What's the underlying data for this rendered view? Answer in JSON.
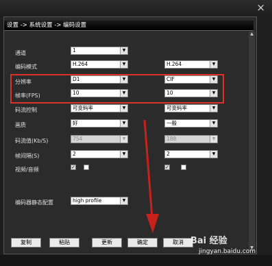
{
  "window": {
    "breadcrumb": "设置 -> 系统设置 -> 编码设置",
    "close": "×"
  },
  "rows": {
    "channel": {
      "label": "通道",
      "main": "1"
    },
    "encode_mode": {
      "label": "编码模式",
      "main": "H.264",
      "sub": "H.264"
    },
    "resolution": {
      "label": "分辨率",
      "main": "D1",
      "sub": "CIF"
    },
    "fps": {
      "label": "帧率(FPS)",
      "main": "10",
      "sub": "10"
    },
    "bitrate_ctrl": {
      "label": "码流控制",
      "main": "可变码率",
      "sub": "可变码率"
    },
    "quality": {
      "label": "画质",
      "main": "好",
      "sub": "一般"
    },
    "bitrate": {
      "label": "码流值(Kb/S)",
      "main": "754",
      "sub": "188"
    },
    "iframe": {
      "label": "帧间隔(S)",
      "main": "2",
      "sub": "2"
    },
    "av": {
      "label": "视频/音频",
      "main_video": true,
      "main_audio": false,
      "sub_video": true,
      "sub_audio": false
    },
    "profile": {
      "label": "编码器静态配置",
      "main": "high profile"
    }
  },
  "buttons": {
    "copy": "复制",
    "paste": "粘贴",
    "refresh": "更新",
    "ok": "确定",
    "cancel": "取消"
  },
  "watermark": {
    "brand": "Bai 经验",
    "url": "jingyan.baidu.com"
  },
  "colors": {
    "highlight": "#e0302a",
    "arrow": "#c8211b"
  }
}
